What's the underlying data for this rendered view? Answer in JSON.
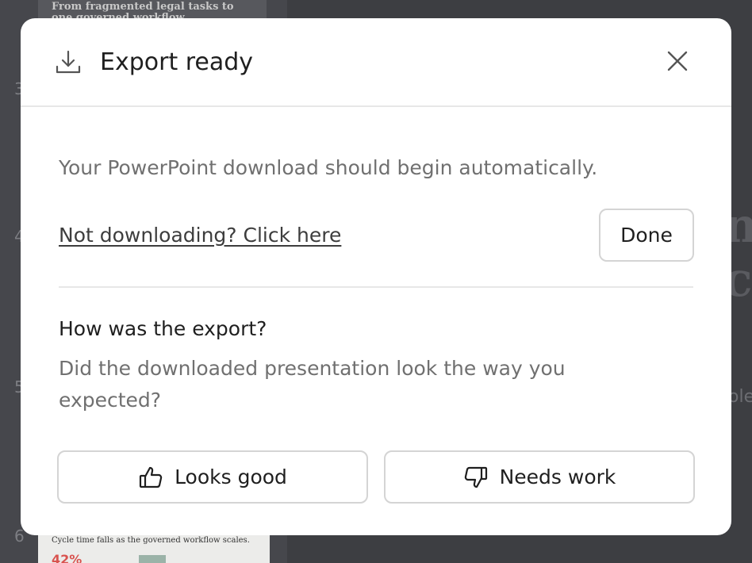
{
  "background": {
    "thumb_top_text": "From fragmented legal tasks to one governed workflow",
    "thumb_bottom_text": "Cycle time falls as the governed workflow scales.",
    "thumb_bottom_pct": "42%",
    "slide_numbers": [
      "3",
      "4",
      "5",
      "6"
    ],
    "right_fragments": [
      "nc",
      "co"
    ],
    "right_small_fragment": "olex"
  },
  "modal": {
    "title": "Export ready",
    "icons": {
      "header": "download-icon",
      "close": "close-icon",
      "positive": "thumbs-up-icon",
      "negative": "thumbs-down-icon"
    },
    "message": "Your PowerPoint download should begin automatically.",
    "fallback_link": "Not downloading? Click here",
    "done_label": "Done",
    "feedback": {
      "heading": "How was the export?",
      "question": "Did the downloaded presentation look the way you expected?",
      "positive_label": "Looks good",
      "negative_label": "Needs work"
    }
  },
  "colors": {
    "backdrop": "#3d3e42",
    "modal_bg": "#ffffff",
    "title_text": "#1f1f1f",
    "muted_text": "#707070",
    "border": "#d4d4d4"
  }
}
